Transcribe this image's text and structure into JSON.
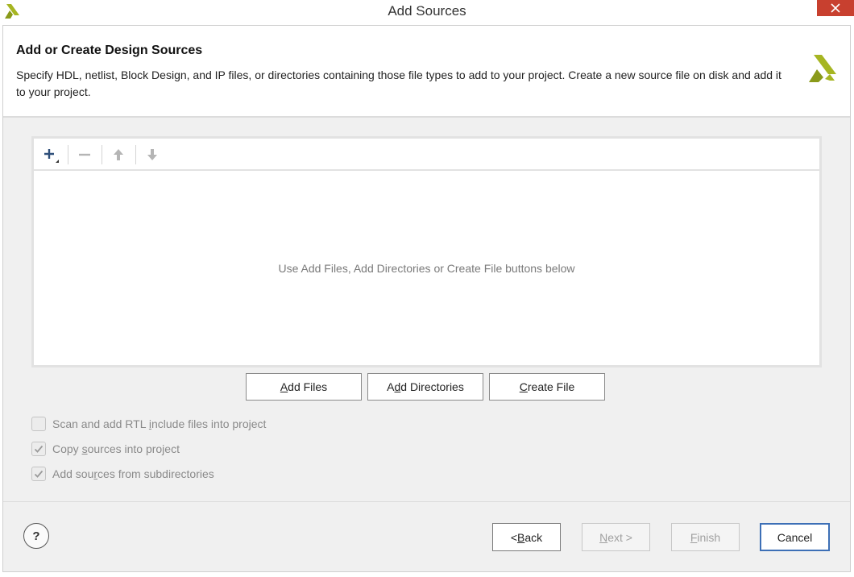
{
  "window": {
    "title": "Add Sources",
    "logo_icon": "xilinx-logo-icon",
    "close_icon": "close-icon",
    "accent_color": "#c8402f"
  },
  "header": {
    "title": "Add or Create Design Sources",
    "description": "Specify HDL, netlist, Block Design, and IP files, or directories containing those file types to add to your project. Create a new source file on disk and add it to your project.",
    "logo_icon": "xilinx-logo-icon",
    "logo_color": "#a6b522"
  },
  "toolbar": {
    "buttons": [
      {
        "icon": "add-icon",
        "enabled": true
      },
      {
        "icon": "remove-icon",
        "enabled": false
      },
      {
        "icon": "move-up-icon",
        "enabled": false
      },
      {
        "icon": "move-down-icon",
        "enabled": false
      }
    ]
  },
  "file_list": {
    "empty_message": "Use Add Files, Add Directories or Create File buttons below"
  },
  "actions": {
    "add_files": {
      "prefix": "",
      "mnemonic": "A",
      "rest": "dd Files"
    },
    "add_directories": {
      "prefix": "A",
      "mnemonic": "d",
      "rest": "d Directories"
    },
    "create_file": {
      "prefix": "",
      "mnemonic": "C",
      "rest": "reate File"
    }
  },
  "options": [
    {
      "prefix": "Scan and add RTL ",
      "mnemonic": "i",
      "rest": "nclude files into project",
      "checked": false
    },
    {
      "prefix": "Copy ",
      "mnemonic": "s",
      "rest": "ources into project",
      "checked": true
    },
    {
      "prefix": "Add sou",
      "mnemonic": "r",
      "rest": "ces from subdirectories",
      "checked": true
    }
  ],
  "footer": {
    "help_label": "?",
    "back": {
      "prefix": "< ",
      "mnemonic": "B",
      "rest": "ack",
      "enabled": true
    },
    "next": {
      "prefix": "",
      "mnemonic": "N",
      "rest": "ext >",
      "enabled": false
    },
    "finish": {
      "prefix": "",
      "mnemonic": "F",
      "rest": "inish",
      "enabled": false
    },
    "cancel": {
      "label": "Cancel",
      "enabled": true
    }
  }
}
